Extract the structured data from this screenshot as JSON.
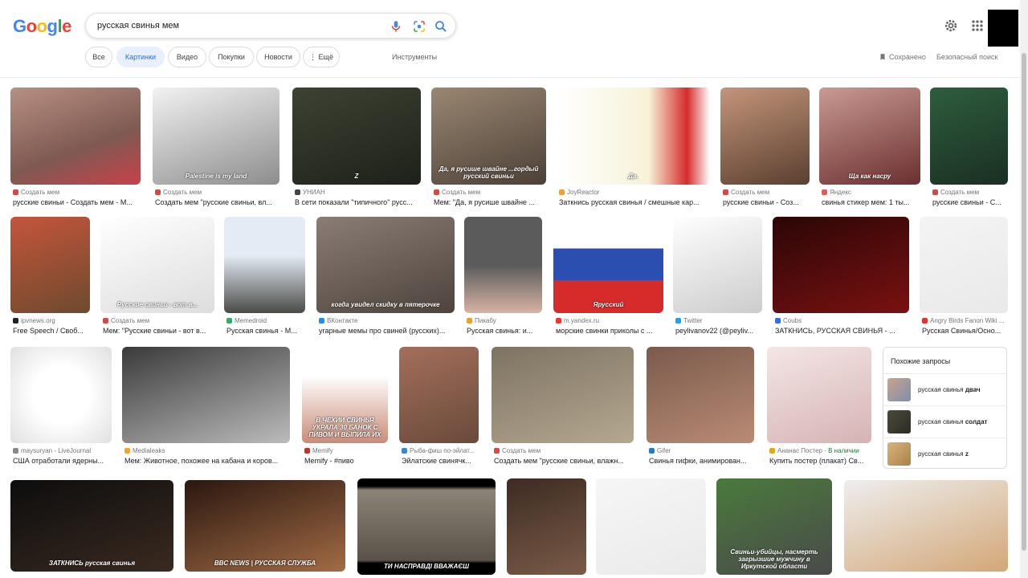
{
  "logo": {
    "letters": [
      "G",
      "o",
      "o",
      "g",
      "l",
      "e"
    ]
  },
  "search": {
    "query": "русская свинья мем"
  },
  "chips": [
    {
      "label": "Все",
      "active": false
    },
    {
      "label": "Картинки",
      "active": true
    },
    {
      "label": "Видео",
      "active": false
    },
    {
      "label": "Покупки",
      "active": false
    },
    {
      "label": "Новости",
      "active": false
    },
    {
      "label": "⋮ Ещё",
      "active": false
    }
  ],
  "toolbar": {
    "tools": "Инструменты",
    "saved": "Сохранено",
    "safesearch": "Безопасный поиск"
  },
  "colors": {
    "accent": "#1a73e8",
    "chip_active_bg": "#e8f0fe"
  },
  "results": [
    {
      "source": "Создать мем",
      "title": "русские свиньи - Создать мем - М...",
      "caption": ""
    },
    {
      "source": "Создать мем",
      "title": "Создать мем \"русские свиньи, вл...",
      "caption": "Palestine is my land"
    },
    {
      "source": "УНИАН",
      "title": "В сети показали \"типичного\" русс...",
      "caption": "Z"
    },
    {
      "source": "Создать мем",
      "title": "Мем: \"Да, я русише швайне ...",
      "caption": "Да, я русише швайне ...гордый русский свиньи"
    },
    {
      "source": "JoyReactor",
      "title": "Заткнись русская свинья / смешные кар...",
      "caption": "Да."
    },
    {
      "source": "Создать мем",
      "title": "русские свиньи - Соз...",
      "caption": ""
    },
    {
      "source": "Яндекс",
      "title": "свинья стикер мем: 1 ты...",
      "caption": "Ща как насру"
    },
    {
      "source": "Создать мем",
      "title": "русские свиньи - С...",
      "caption": ""
    },
    {
      "source": "ipvnews.org",
      "title": "Free Speech / Своб...",
      "caption": ""
    },
    {
      "source": "Создать мем",
      "title": "Мем: \"Русские свиньи - вот в...",
      "caption": "Русские свиньи - вот в..."
    },
    {
      "source": "Memedroid",
      "title": "Русская свинья - М...",
      "caption": ""
    },
    {
      "source": "ВКонтакте",
      "title": "угарные мемы про свиней (русских)...",
      "caption": "когда увидел скидку в пятерочке"
    },
    {
      "source": "Пикабу",
      "title": "Русская свинья: и...",
      "caption": ""
    },
    {
      "source": "m.yandex.ru",
      "title": "морские свинки приколы с ...",
      "caption": "Ярусский"
    },
    {
      "source": "Twitter",
      "title": "peylivanov22 (@peyliv...",
      "caption": ""
    },
    {
      "source": "Coubs",
      "title": "ЗАТКНИСЬ, РУССКАЯ СВИНЬЯ - ...",
      "caption": ""
    },
    {
      "source": "Angry Birds Fanon Wiki ...",
      "title": "Русская Свинья/Осно...",
      "caption": ""
    },
    {
      "source": "maysuryan - LiveJournal",
      "title": "США отработали ядерны...",
      "caption": ""
    },
    {
      "source": "Medialeaks",
      "title": "Мем: Животное, похожее на кабана и коров...",
      "caption": ""
    },
    {
      "source": "Memify",
      "title": "Memify - #пиво",
      "caption": "В ЧЕХИИ СВИНЬЯ УКРАЛА 30 БАНОК С ПИВОМ И ВЫПИЛА ИХ"
    },
    {
      "source": "Рыба-фиш по-эйлат...",
      "title": "Эйлатские свинячк...",
      "caption": ""
    },
    {
      "source": "Создать мем",
      "title": "Создать мем \"русские свиньи, влажн...",
      "caption": ""
    },
    {
      "source": "Gifer",
      "title": "Свинья гифки, анимирован...",
      "caption": ""
    },
    {
      "source": "Ананас Постер",
      "title": "Купить постер (плакат) Св...",
      "caption": "",
      "extra": "В наличии"
    },
    {
      "source": "",
      "title": "",
      "caption": "ЗАТКНИСЬ русская свинья"
    },
    {
      "source": "",
      "title": "",
      "caption": "BBC NEWS | РУССКАЯ СЛУЖБА"
    },
    {
      "source": "",
      "title": "",
      "caption": "ТИ НАСПРАВДІ ВВАЖАЄШ"
    },
    {
      "source": "",
      "title": "",
      "caption": ""
    },
    {
      "source": "",
      "title": "",
      "caption": ""
    },
    {
      "source": "",
      "title": "",
      "caption": "Свиньи-убийцы, насмерть загрызшие мужчину в Иркутской области"
    },
    {
      "source": "",
      "title": "",
      "caption": ""
    }
  ],
  "related": {
    "header": "Похожие запросы",
    "items": [
      {
        "prefix": "русская свинья ",
        "bold": "двач"
      },
      {
        "prefix": "русская свинья ",
        "bold": "солдат"
      },
      {
        "prefix": "русская свинья ",
        "bold": "z"
      }
    ]
  }
}
